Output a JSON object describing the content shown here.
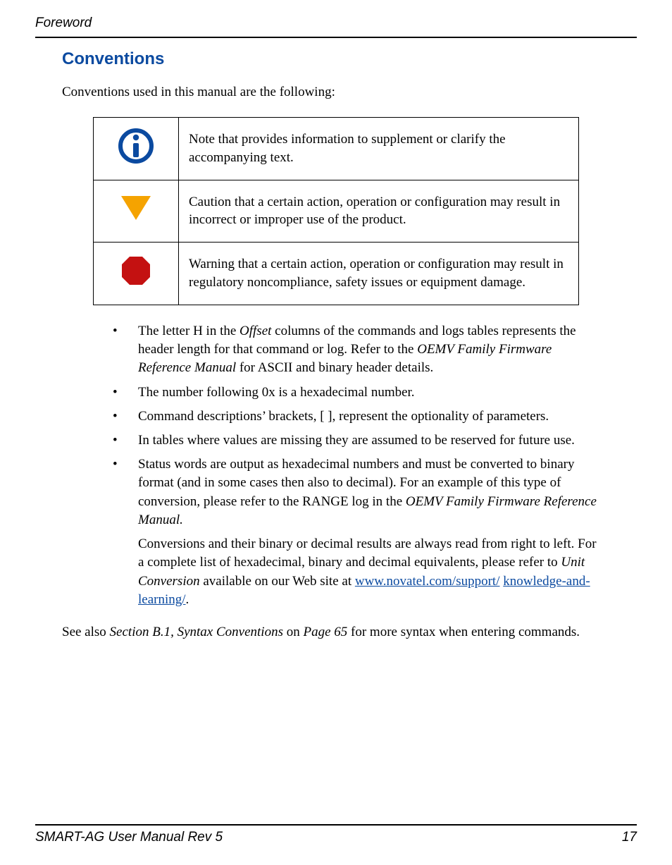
{
  "header": {
    "section": "Foreword"
  },
  "title": "Conventions",
  "intro": "Conventions used in this manual are the following:",
  "conventions": {
    "note": "Note that provides information to supplement or clarify the accompanying text.",
    "caution": "Caution that a certain action, operation or configuration may result in incorrect or improper use of the product.",
    "warning": "Warning that a certain action, operation or configuration may result in regulatory noncompliance, safety issues or equipment damage."
  },
  "bullets": {
    "b1a": "The letter H in the ",
    "b1b": "Offset",
    "b1c": " columns of the commands and logs tables represents the header length for that command or log. Refer to the ",
    "b1d": "OEMV Family Firmware Reference Manual",
    "b1e": " for ASCII and binary header details.",
    "b2": "The number following 0x is a hexadecimal number.",
    "b3": "Command descriptions’ brackets, [ ], represent the optionality of parameters.",
    "b4": "In tables where values are missing they are assumed to be reserved for future use.",
    "b5a": "Status words are output as hexadecimal numbers and must be converted to binary format (and in some cases then also to decimal). For an example of this type of conversion, please refer to the RANGE log in the ",
    "b5b": "OEMV Family Firmware Reference Manual.",
    "sub_a": "Conversions and their binary or decimal results are always read from right to left. For a complete list of hexadecimal, binary and decimal equivalents, please refer to ",
    "sub_b": "Unit Conversion",
    "sub_c": " available on our Web site at ",
    "link1": "www.novatel.com/support/",
    "link2": "knowledge-and-learning/",
    "sub_end": "."
  },
  "seealso": {
    "a": "See also ",
    "b": "Section B.1, Syntax Conventions",
    "c": " on ",
    "d": "Page 65",
    "e": " for more syntax when entering commands."
  },
  "footer": {
    "left": "SMART-AG User Manual Rev 5",
    "right": "17"
  }
}
